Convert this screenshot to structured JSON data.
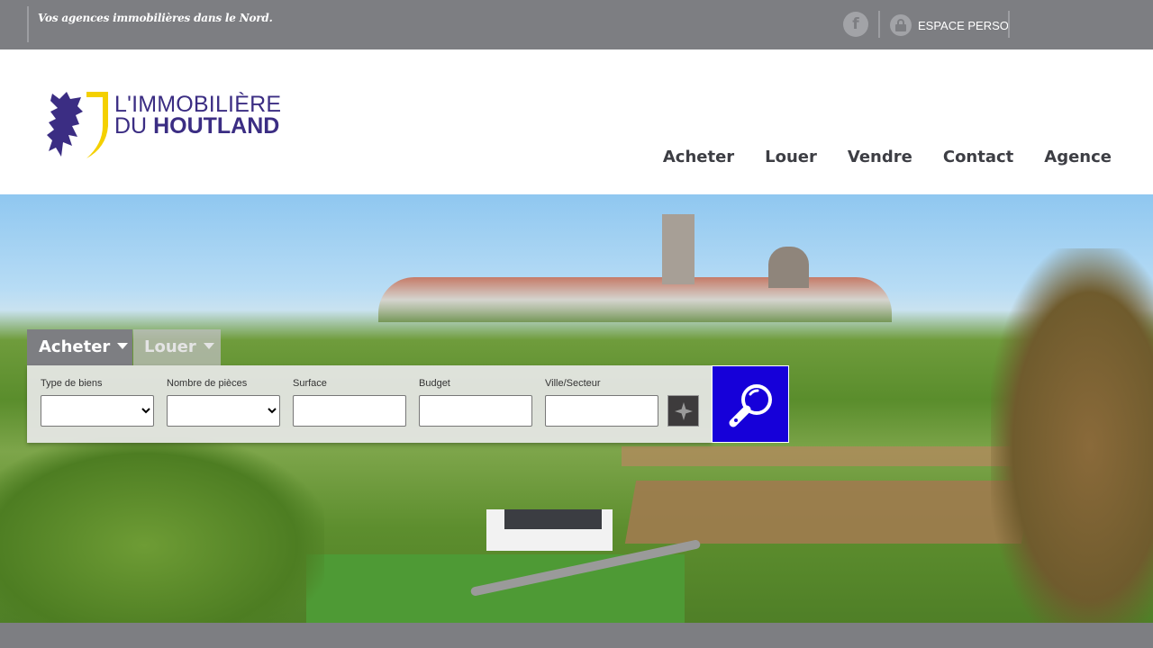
{
  "topbar": {
    "tagline": "Vos agences immobilières dans le Nord.",
    "facebook_glyph": "f",
    "espace_label": "ESPACE PERSO"
  },
  "logo": {
    "line1": "L'IMMOBILIÈRE",
    "line2_a": "DU ",
    "line2_b": "HOUTLAND",
    "brand_color": "#3b2d83",
    "accent_color": "#f4d000"
  },
  "nav": {
    "items": [
      "Acheter",
      "Louer",
      "Vendre",
      "Contact",
      "Agence"
    ]
  },
  "search": {
    "tab_active": "Acheter",
    "tab_inactive": "Louer",
    "fields": {
      "type_label": "Type de biens",
      "type_value": "",
      "pieces_label": "Nombre de pièces",
      "pieces_value": "",
      "surface_label": "Surface",
      "surface_value": "",
      "budget_label": "Budget",
      "budget_value": "",
      "ville_label": "Ville/Secteur",
      "ville_value": ""
    },
    "button_color": "#1600d9",
    "icons": {
      "locate": "compass-star-icon",
      "search": "magnifier-icon"
    }
  }
}
